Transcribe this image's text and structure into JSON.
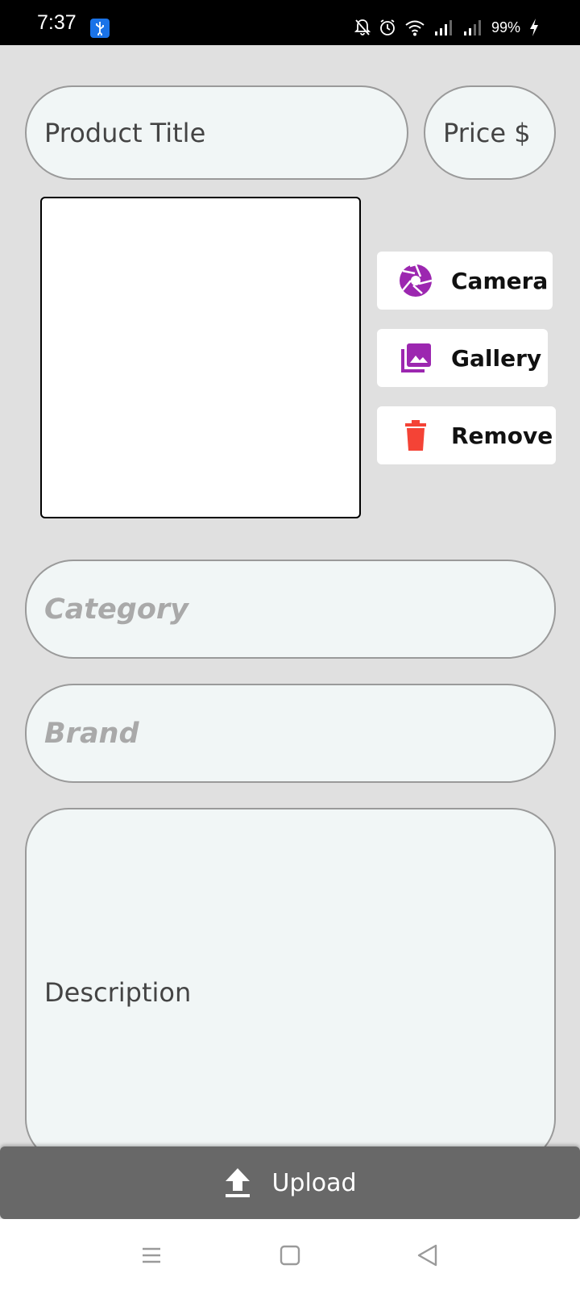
{
  "status_bar": {
    "time": "7:37",
    "battery": "99%",
    "icons": [
      "usb-icon",
      "bell-off-icon",
      "alarm-icon",
      "wifi-icon",
      "signal-icon",
      "signal-icon",
      "charging-icon"
    ]
  },
  "form": {
    "title_placeholder": "Product Title",
    "price_placeholder": "Price $",
    "category_hint": "Category",
    "brand_hint": "Brand",
    "description_placeholder": "Description"
  },
  "image_actions": {
    "camera_label": "Camera",
    "gallery_label": "Gallery",
    "remove_label": "Remove"
  },
  "upload": {
    "label": "Upload"
  },
  "nav": {
    "buttons": [
      "menu-icon",
      "home-icon",
      "back-icon"
    ]
  },
  "colors": {
    "accent": "#9c27b0",
    "danger": "#f44336",
    "field_bg": "#f1f6f6",
    "page_bg": "#e0e0e0",
    "upload_bg": "#686868"
  }
}
